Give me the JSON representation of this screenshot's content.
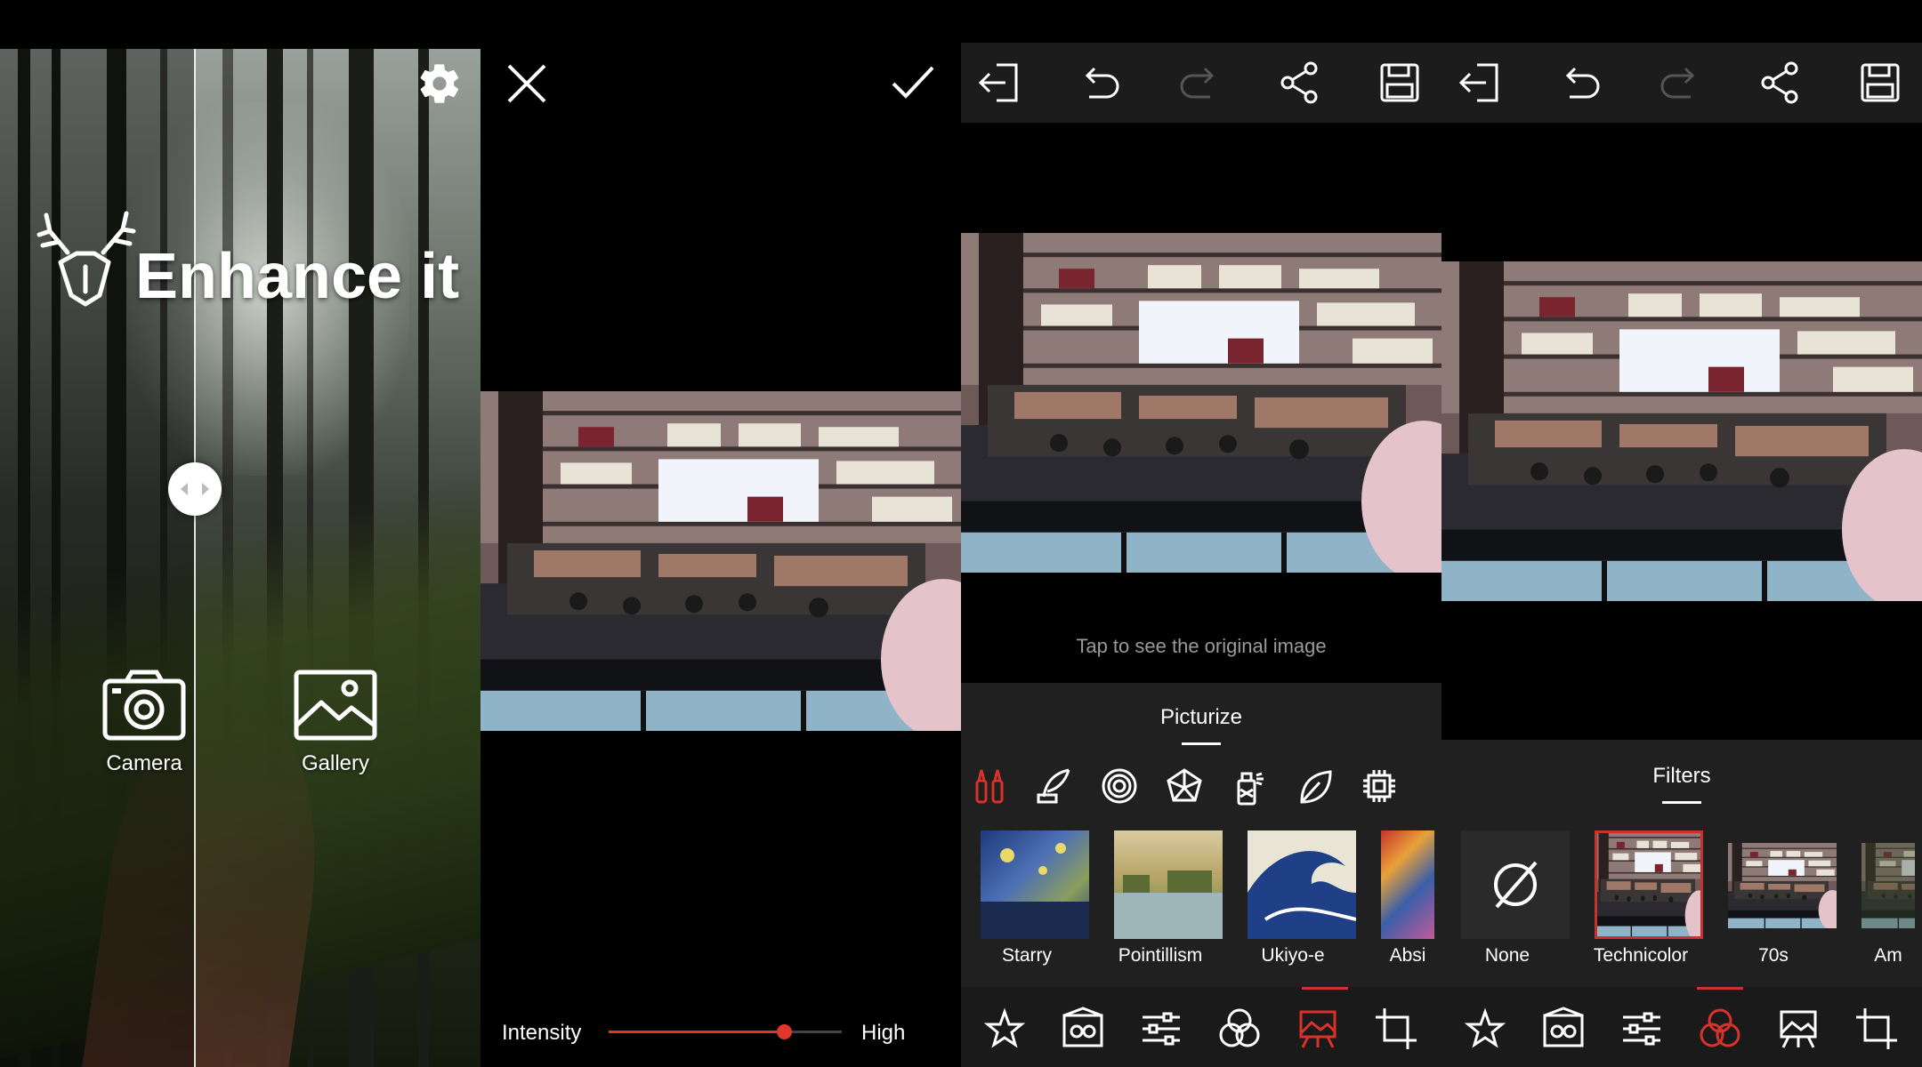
{
  "home": {
    "title": "Enhance it",
    "camera_label": "Camera",
    "gallery_label": "Gallery",
    "icons": [
      "settings-gear-icon",
      "deer-logo-icon",
      "camera-icon",
      "gallery-icon",
      "split-arrows-icon"
    ]
  },
  "intensity": {
    "label": "Intensity",
    "value_label": "High",
    "value": 0.75,
    "accent": "#e0362c",
    "icons": [
      "close-icon",
      "check-icon"
    ]
  },
  "editor_a": {
    "toolbar": [
      "exit-icon",
      "undo-icon",
      "redo-icon",
      "share-icon",
      "save-icon"
    ],
    "hint": "Tap to see the original image",
    "sheet_title": "Picturize",
    "categories": [
      "brushes-icon",
      "quill-icon",
      "swirl-icon",
      "polygon-icon",
      "spray-can-icon",
      "leaf-icon",
      "chip-icon"
    ],
    "thumbnails": [
      {
        "label": "Starry"
      },
      {
        "label": "Pointillism"
      },
      {
        "label": "Ukiyo-e"
      },
      {
        "label": "Absi"
      }
    ],
    "bottom_tools": [
      "magic-icon",
      "stylize-icon",
      "adjust-icon",
      "filters-icon",
      "picturize-icon",
      "crop-icon"
    ],
    "active_tool": "picturize-icon"
  },
  "editor_b": {
    "toolbar": [
      "exit-icon",
      "undo-icon",
      "redo-icon",
      "share-icon",
      "save-icon"
    ],
    "sheet_title": "Filters",
    "thumbnails": [
      {
        "label": "None"
      },
      {
        "label": "Technicolor"
      },
      {
        "label": "70s"
      },
      {
        "label": "Am"
      }
    ],
    "selected_filter": "Technicolor",
    "bottom_tools": [
      "magic-icon",
      "stylize-icon",
      "adjust-icon",
      "filters-icon",
      "picturize-icon",
      "crop-icon"
    ],
    "active_tool": "filters-icon"
  }
}
